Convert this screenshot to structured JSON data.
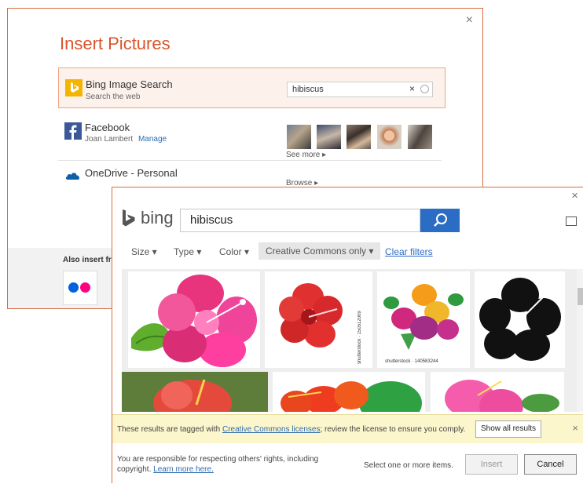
{
  "insert_pictures": {
    "title": "Insert Pictures",
    "close_glyph": "×",
    "bing": {
      "title": "Bing Image Search",
      "subtitle": "Search the web",
      "search_value": "hibiscus",
      "clear_glyph": "×",
      "icon": "bing-logo-icon",
      "color": "#f5b400"
    },
    "facebook": {
      "title": "Facebook",
      "user": "Joan Lambert",
      "manage": "Manage",
      "see_more": "See more ▸",
      "icon": "facebook-icon",
      "color": "#3b5998"
    },
    "onedrive": {
      "title": "OneDrive - Personal",
      "browse": "Browse ▸",
      "icon": "onedrive-cloud-icon",
      "color": "#0f5fa8"
    },
    "also_insert": "Also insert from:",
    "flickr_icon": "flickr-icon"
  },
  "bing_dialog": {
    "close_glyph": "×",
    "logo_text": "bing",
    "search_value": "hibiscus",
    "accent": "#2b6cc4",
    "filters": {
      "size": "Size ▾",
      "type": "Type ▾",
      "color": "Color ▾",
      "license": "Creative Commons only ▾",
      "clear": "Clear filters"
    },
    "watermarks": {
      "wm1": "shutterstock · 150512009",
      "wm2": "shutterstock · 140583244"
    },
    "notice": {
      "before": "These results are tagged with ",
      "link": "Creative Commons licenses",
      "after": "; review the license to ensure you comply.",
      "button": "Show all results",
      "close_glyph": "×",
      "bg": "#fcf6cc"
    },
    "footer": {
      "resp_line1": "You are responsible for respecting others' rights, including",
      "resp_line2": "copyright. ",
      "learn_more": "Learn more here.",
      "select_hint": "Select one or more items.",
      "insert": "Insert",
      "cancel": "Cancel"
    }
  }
}
